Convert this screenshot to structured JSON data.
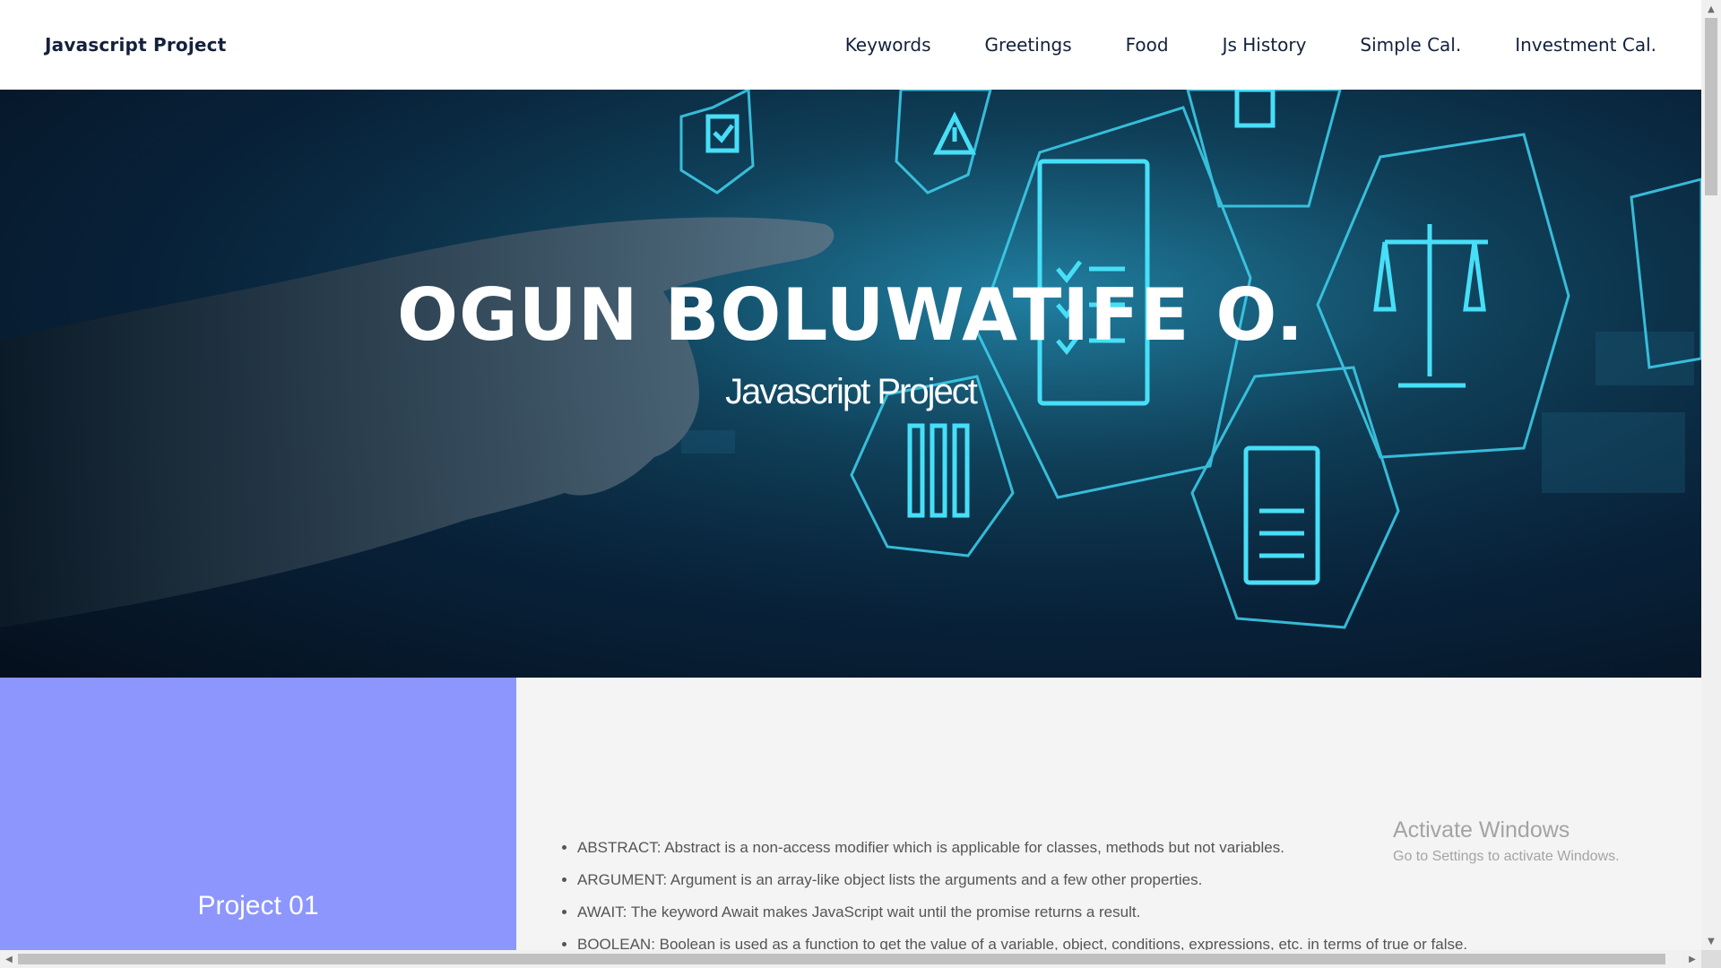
{
  "nav": {
    "brand": "Javascript Project",
    "links": [
      "Keywords",
      "Greetings",
      "Food",
      "Js History",
      "Simple Cal.",
      "Investment Cal."
    ]
  },
  "hero": {
    "title": "OGUN BOLUWATIFE O.",
    "subtitle": "Javascript Project"
  },
  "project": {
    "label": "Project 01",
    "keywords": [
      "ABSTRACT: Abstract is a non-access modifier which is applicable for classes, methods but not variables.",
      "ARGUMENT: Argument is an array-like object lists the arguments and a few other properties.",
      "AWAIT: The keyword Await makes JavaScript wait until the promise returns a result.",
      "BOOLEAN: Boolean is used as a function to get the value of a variable, object, conditions, expressions, etc. in terms of true or false."
    ]
  },
  "watermark": {
    "title": "Activate Windows",
    "subtitle": "Go to Settings to activate Windows."
  },
  "colors": {
    "nav_text": "#14213d",
    "left_panel": "#8c96fd",
    "right_panel": "#f4f4f4",
    "hero_accent": "#3fd3f0"
  },
  "icons": [
    "checkbox-icon",
    "warning-icon",
    "document-checklist-icon",
    "scales-of-justice-icon",
    "binders-icon",
    "certificate-icon",
    "document-list-icon"
  ]
}
